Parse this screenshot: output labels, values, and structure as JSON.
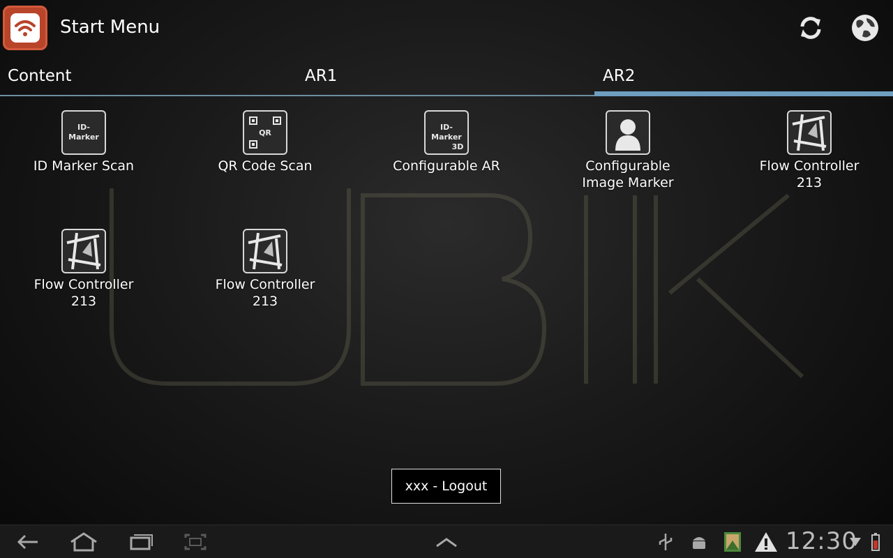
{
  "actionbar": {
    "title": "Start Menu",
    "app_icon": "wifi-app-icon",
    "refresh_icon": "refresh-icon",
    "globe_icon": "globe-icon"
  },
  "tabs": [
    {
      "label": "Content",
      "selected": false
    },
    {
      "label": "AR1",
      "selected": false
    },
    {
      "label": "AR2",
      "selected": true
    }
  ],
  "tiles": [
    {
      "label": "ID Marker Scan",
      "icon": "id-marker-icon",
      "icon_text": [
        "ID-",
        "Marker"
      ]
    },
    {
      "label": "QR Code Scan",
      "icon": "qr-code-icon",
      "icon_text": [
        "QR"
      ]
    },
    {
      "label": "Configurable AR",
      "icon": "id-marker-3d-icon",
      "icon_text": [
        "ID-",
        "Marker",
        "3D"
      ]
    },
    {
      "label": "Configurable",
      "label2": "Image Marker",
      "icon": "person-icon"
    },
    {
      "label": "Flow Controller",
      "label2": "213",
      "icon": "flow-controller-icon"
    },
    {
      "label": "Flow Controller",
      "label2": "213",
      "icon": "flow-controller-icon"
    },
    {
      "label": "Flow Controller",
      "label2": "213",
      "icon": "flow-controller-icon"
    }
  ],
  "logout": {
    "label": "xxx - Logout"
  },
  "watermark": {
    "text": "UBIK"
  },
  "systembar": {
    "clock": "12:30",
    "icons": [
      "back-icon",
      "home-icon",
      "recent-apps-icon",
      "screenshot-icon",
      "chevron-up-icon",
      "usb-icon",
      "android-debug-icon",
      "image-notification-icon",
      "warning-icon",
      "wifi-signal-icon",
      "battery-icon"
    ]
  },
  "colors": {
    "accent": "#6e9ec0",
    "app_icon": "#b8442a"
  }
}
